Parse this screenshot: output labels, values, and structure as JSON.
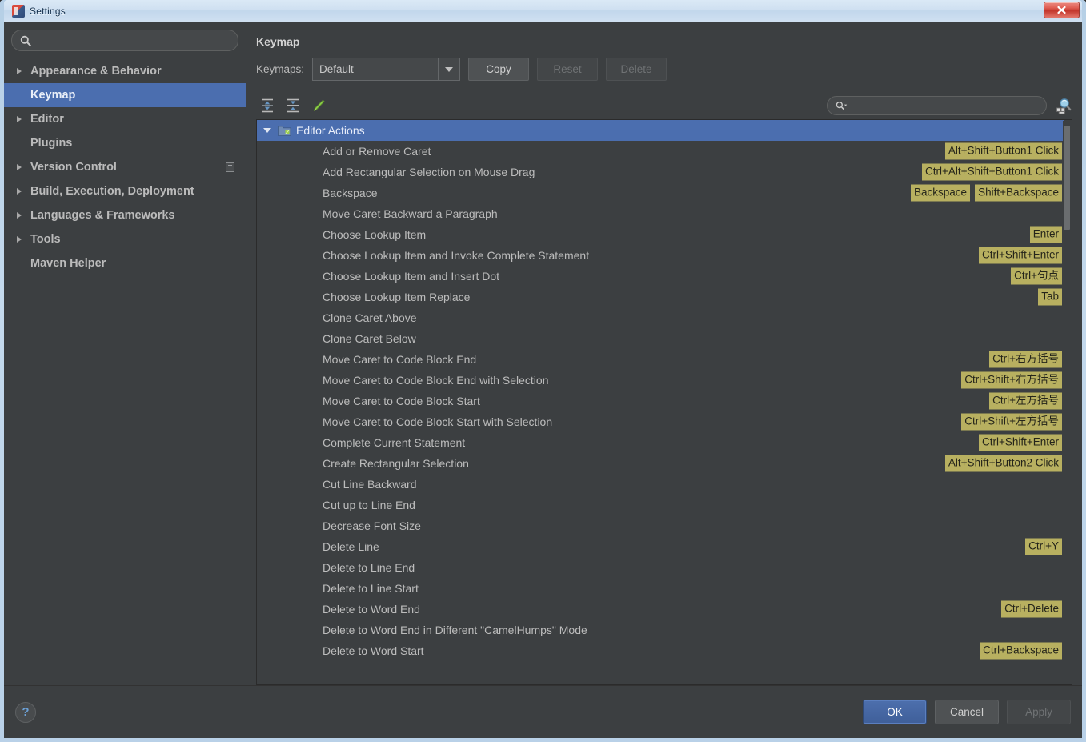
{
  "window": {
    "title": "Settings",
    "title_icon": "intellij-idea-icon",
    "close_label": "Close"
  },
  "sidebar": {
    "search": {
      "value": "",
      "placeholder": "",
      "icon": "search-icon"
    },
    "items": [
      {
        "label": "Appearance & Behavior",
        "expandable": true,
        "selected": false,
        "badge": false
      },
      {
        "label": "Keymap",
        "expandable": false,
        "selected": true,
        "badge": false
      },
      {
        "label": "Editor",
        "expandable": true,
        "selected": false,
        "badge": false
      },
      {
        "label": "Plugins",
        "expandable": false,
        "selected": false,
        "badge": false
      },
      {
        "label": "Version Control",
        "expandable": true,
        "selected": false,
        "badge": true
      },
      {
        "label": "Build, Execution, Deployment",
        "expandable": true,
        "selected": false,
        "badge": false
      },
      {
        "label": "Languages & Frameworks",
        "expandable": true,
        "selected": false,
        "badge": false
      },
      {
        "label": "Tools",
        "expandable": true,
        "selected": false,
        "badge": false
      },
      {
        "label": "Maven Helper",
        "expandable": false,
        "selected": false,
        "badge": false
      }
    ]
  },
  "main": {
    "title": "Keymap",
    "keymaps_label": "Keymaps:",
    "keymap_selected": "Default",
    "keymap_options": [
      "Default"
    ],
    "buttons": {
      "copy": "Copy",
      "reset": "Reset",
      "delete": "Delete"
    },
    "toolbar_icons": [
      {
        "name": "expand-all-icon"
      },
      {
        "name": "collapse-all-icon"
      },
      {
        "name": "edit-shortcut-icon"
      }
    ],
    "find": {
      "value": "",
      "placeholder": "",
      "icon": "search-dropdown-icon"
    },
    "find_by_shortcut_icon": "find-by-shortcut-icon",
    "group": {
      "label": "Editor Actions",
      "expanded": true,
      "icon": "folder-icon"
    },
    "actions": [
      {
        "name": "Add or Remove Caret",
        "shortcuts": [
          "Alt+Shift+Button1 Click"
        ]
      },
      {
        "name": "Add Rectangular Selection on Mouse Drag",
        "shortcuts": [
          "Ctrl+Alt+Shift+Button1 Click"
        ]
      },
      {
        "name": "Backspace",
        "shortcuts": [
          "Backspace",
          "Shift+Backspace"
        ]
      },
      {
        "name": "Move Caret Backward a Paragraph",
        "shortcuts": []
      },
      {
        "name": "Choose Lookup Item",
        "shortcuts": [
          "Enter"
        ]
      },
      {
        "name": "Choose Lookup Item and Invoke Complete Statement",
        "shortcuts": [
          "Ctrl+Shift+Enter"
        ]
      },
      {
        "name": "Choose Lookup Item and Insert Dot",
        "shortcuts": [
          "Ctrl+句点"
        ]
      },
      {
        "name": "Choose Lookup Item Replace",
        "shortcuts": [
          "Tab"
        ]
      },
      {
        "name": "Clone Caret Above",
        "shortcuts": []
      },
      {
        "name": "Clone Caret Below",
        "shortcuts": []
      },
      {
        "name": "Move Caret to Code Block End",
        "shortcuts": [
          "Ctrl+右方括号"
        ]
      },
      {
        "name": "Move Caret to Code Block End with Selection",
        "shortcuts": [
          "Ctrl+Shift+右方括号"
        ]
      },
      {
        "name": "Move Caret to Code Block Start",
        "shortcuts": [
          "Ctrl+左方括号"
        ]
      },
      {
        "name": "Move Caret to Code Block Start with Selection",
        "shortcuts": [
          "Ctrl+Shift+左方括号"
        ]
      },
      {
        "name": "Complete Current Statement",
        "shortcuts": [
          "Ctrl+Shift+Enter"
        ]
      },
      {
        "name": "Create Rectangular Selection",
        "shortcuts": [
          "Alt+Shift+Button2 Click"
        ]
      },
      {
        "name": "Cut Line Backward",
        "shortcuts": []
      },
      {
        "name": "Cut up to Line End",
        "shortcuts": []
      },
      {
        "name": "Decrease Font Size",
        "shortcuts": []
      },
      {
        "name": "Delete Line",
        "shortcuts": [
          "Ctrl+Y"
        ]
      },
      {
        "name": "Delete to Line End",
        "shortcuts": []
      },
      {
        "name": "Delete to Line Start",
        "shortcuts": []
      },
      {
        "name": "Delete to Word End",
        "shortcuts": [
          "Ctrl+Delete"
        ]
      },
      {
        "name": "Delete to Word End in Different \"CamelHumps\" Mode",
        "shortcuts": []
      },
      {
        "name": "Delete to Word Start",
        "shortcuts": [
          "Ctrl+Backspace"
        ]
      }
    ]
  },
  "footer": {
    "help": "?",
    "ok": "OK",
    "cancel": "Cancel",
    "apply": "Apply"
  },
  "colors": {
    "selection_blue": "#4b6eaf",
    "shortcut_badge": "#b8b060",
    "panel_bg": "#3c3f41",
    "close_red": "#c3362c"
  }
}
